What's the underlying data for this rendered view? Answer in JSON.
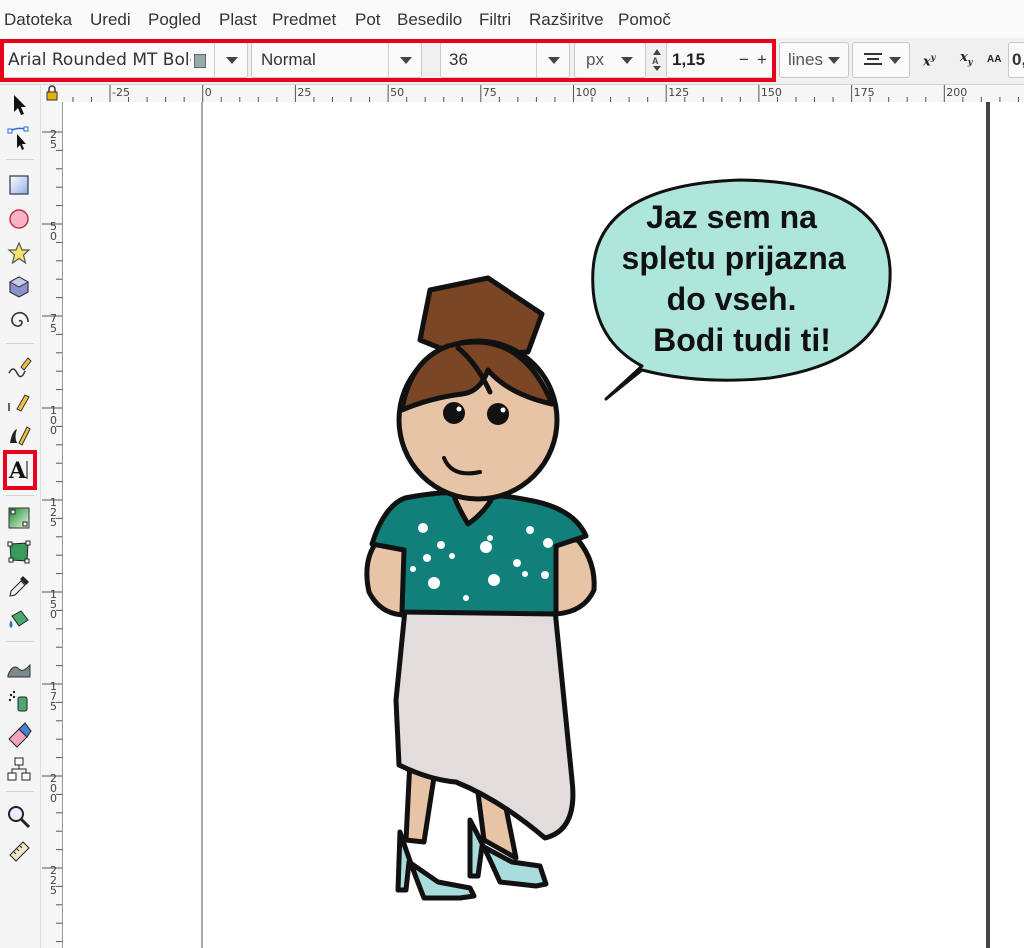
{
  "menu": {
    "items": [
      "Datoteka",
      "Uredi",
      "Pogled",
      "Plast",
      "Predmet",
      "Pot",
      "Besedilo",
      "Filtri",
      "Razširitve",
      "Pomoč"
    ]
  },
  "text_toolbar": {
    "font_family": "Arial Rounded MT Bolc",
    "font_style": "Normal",
    "font_size": "36",
    "unit": "px",
    "line_height": "1,15",
    "minus_label": "−",
    "plus_label": "+",
    "spacing_mode": "lines",
    "alignment_icon": "align-center-icon",
    "superscript_icon": "superscript-icon",
    "subscript_icon": "subscript-icon",
    "letter_spacing_icon": "letter-spacing-icon",
    "letter_spacing_value": "0,"
  },
  "rulers": {
    "top_labels": [
      "-25",
      "0",
      "25",
      "50",
      "75",
      "100",
      "125",
      "150",
      "175",
      "200"
    ],
    "left_labels": [
      "25",
      "50",
      "75",
      "100",
      "125",
      "150",
      "175",
      "200",
      "225"
    ]
  },
  "tools": [
    {
      "name": "selector-tool-icon"
    },
    {
      "name": "node-tool-icon"
    },
    {
      "name": "rectangle-tool-icon"
    },
    {
      "name": "ellipse-tool-icon"
    },
    {
      "name": "star-tool-icon"
    },
    {
      "name": "box3d-tool-icon"
    },
    {
      "name": "spiral-tool-icon"
    },
    {
      "name": "pencil-tool-icon"
    },
    {
      "name": "pen-tool-icon"
    },
    {
      "name": "calligraphy-tool-icon"
    },
    {
      "name": "text-tool-icon",
      "active": true
    },
    {
      "name": "gradient-tool-icon"
    },
    {
      "name": "mesh-tool-icon"
    },
    {
      "name": "dropper-tool-icon"
    },
    {
      "name": "paint-bucket-tool-icon"
    },
    {
      "name": "tweak-tool-icon"
    },
    {
      "name": "spray-tool-icon"
    },
    {
      "name": "eraser-tool-icon"
    },
    {
      "name": "connector-tool-icon"
    },
    {
      "name": "zoom-tool-icon"
    },
    {
      "name": "measure-tool-icon"
    }
  ],
  "canvas": {
    "speech_bubble_lines": [
      "Jaz sem na",
      "spletu prijazna",
      "do vseh.",
      "Bodi tudi ti!"
    ]
  },
  "colors": {
    "highlight": "#e8001c",
    "bubble_fill": "#aee6dc",
    "hair": "#7b4626",
    "skin": "#e8c4a6",
    "shirt": "#11807a",
    "skirt": "#e2dcdd",
    "shoes": "#a9dcdc"
  }
}
